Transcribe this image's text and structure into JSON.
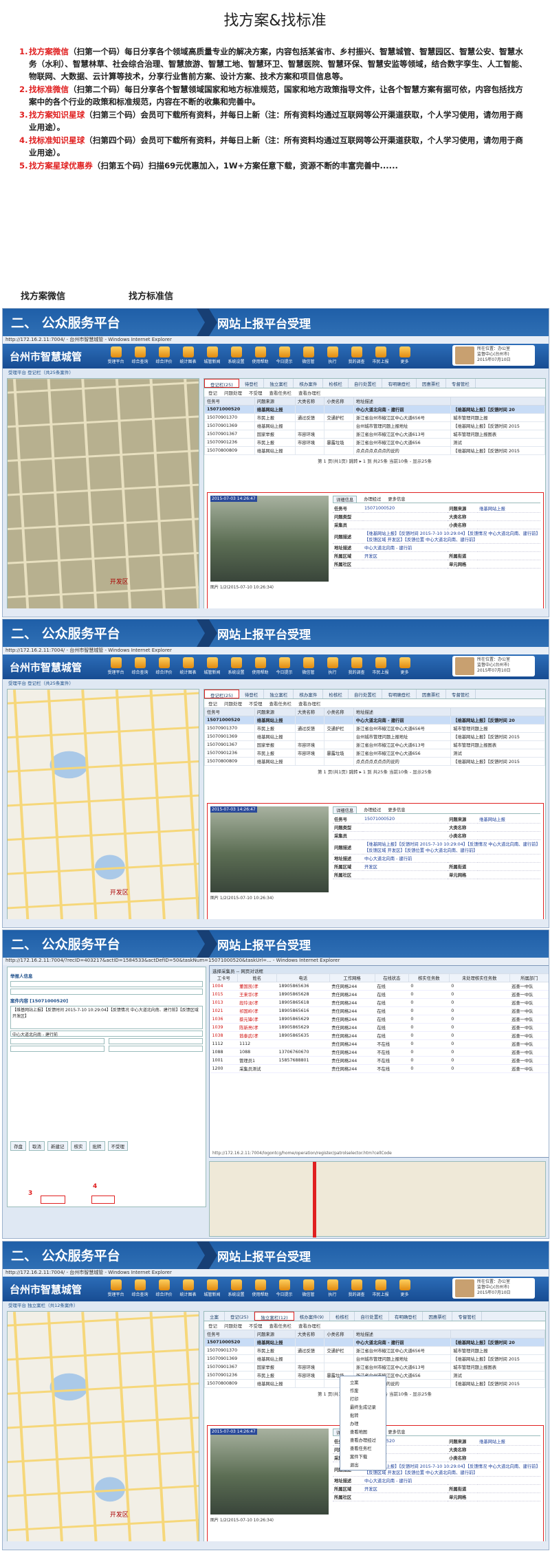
{
  "header": {
    "title": "找方案&找标准",
    "items": [
      {
        "num": "1.",
        "highlight": "找方案微信",
        "text": "（扫第一个码）每日分享各个领域高质量专业的解决方案，内容包括某省市、乡村振兴、智慧城管、智慧园区、智慧公安、智慧水务（水利）、智慧林草、社会综合治理、智慧旅游、智慧工地、智慧环卫、智慧医院、智慧环保、智慧安监等领域，结合数字孪生、人工智能、物联网、大数据、云计算等技术，分享行业售前方案、设计方案、技术方案和项目信息等。"
      },
      {
        "num": "2.",
        "highlight": "找标准微信",
        "text": "（扫第二个码）每日分享各个智慧领域国家和地方标准规范，国家和地方政策指导文件，让各个智慧方案有据可依，内容包括找方案中的各个行业的政策和标准规范，内容在不断的收集和完善中。"
      },
      {
        "num": "3.",
        "highlight": "找方案知识星球",
        "text": "（扫第三个码）会员可下载所有资料，并每日上新（注：所有资料均通过互联网等公开渠道获取，个人学习使用，请勿用于商业用途）。"
      },
      {
        "num": "4.",
        "highlight": "找标准知识星球",
        "text": "（扫第四个码）会员可下载所有资料，并每日上新（注：所有资料均通过互联网等公开渠道获取，个人学习使用，请勿用于商业用途）。"
      },
      {
        "num": "5.",
        "highlight": "找方案星球优惠券",
        "text": "（扫第五个码）扫描69元优惠加入，1W+方案任意下载，资源不断的丰富完善中......"
      }
    ],
    "qr1": "找方案微信",
    "qr2": "找方标准信"
  },
  "slide": {
    "title1": "二、 公众服务平台",
    "title2": "网站上报平台受理",
    "ie_title": "http://172.16.2.11:7004/ - 台州市智慧城管 - Windows Internet Explorer",
    "ie_title3": "http://172.16.2.11:7004/?recID=403217&actID=1584533&actDefID=50&taskNum=15071000520&taskUrl=... - Windows Internet Explorer",
    "app_name": "台州市智慧城管",
    "toolbar": [
      "受理平台",
      "综合查询",
      "综合评价",
      "统计图表",
      "城管新闻",
      "系统设置",
      "使用帮助",
      "今日提示",
      "微信管",
      "执行",
      "我的调查",
      "市民上报",
      "更多"
    ],
    "user_lines": [
      "所在位置：办公室",
      "监督中心(台州市)",
      "2015年07月10日"
    ],
    "logout": "注销",
    "crumb1": "受理平台 登记栏（共25条案件）",
    "crumb4": "受理平台 独立案栏（共12条案件）",
    "tabs": [
      "登记栏(25)",
      "待登栏",
      "独立案栏",
      "核办案件",
      "检核栏",
      "自行处置栏",
      "有明确登栏",
      "因惠票栏",
      "专督管栏"
    ],
    "tabs4": [
      "立案",
      "登记(25)",
      "独立案栏(12)",
      "核办案件(9)",
      "检核栏",
      "自行处置栏",
      "有明确登栏",
      "因惠票栏",
      "专督管栏"
    ],
    "actions": [
      "登记",
      "问题处理",
      "不受理",
      "查看任务栏",
      "查看办理栏"
    ],
    "columns": [
      "任务号",
      "问题来源",
      "大类名称",
      "小类名称",
      "地址描述"
    ],
    "rows": [
      [
        "15071000520",
        "维基网站上报",
        "",
        "",
        "中心大道北向南 - 建行前",
        "【维基网站上报】【反馈时间 20"
      ],
      [
        "15070901370",
        "市民上报",
        "通过反馈",
        "交通护栏",
        "浙江省台州市椒江区中心大道656号",
        "城市管理问题上报"
      ],
      [
        "15070901369",
        "维基网站上报",
        "",
        "",
        "台州城市管理问题上报地址",
        "【维基网站上报】【反馈时间 2015"
      ],
      [
        "15070901367",
        "国家举报",
        "市容环境",
        "",
        "浙江省台州市椒江区中心大道613号",
        "城市管理问题上报图表"
      ],
      [
        "15070901236",
        "市民上报",
        "市容环境",
        "暴露垃圾",
        "浙江省台州市椒江区中心大道656",
        "测试"
      ],
      [
        "15070800809",
        "维基网站上报",
        "",
        "",
        "点点点点点点点的说的",
        "【维基网站上报】【反馈时间 2015"
      ]
    ],
    "pager": "第 1 页(共1页) 跳转 ▸ 1 到 共25条 当前10条 - 显示25条",
    "detail_tabs": [
      "详细信息",
      "办理经过",
      "更多信息"
    ],
    "photo_stamp": "2015-07-03 14:26:47",
    "photo_caption": "图片 1/2(2015-07-10 10:26:34)",
    "fields": [
      [
        "任务号",
        "15071000520",
        "问题来源",
        "维基网站上报"
      ],
      [
        "问题类型",
        "",
        "大类名称",
        ""
      ],
      [
        "采集员",
        "",
        "小类名称",
        ""
      ],
      [
        "问题描述",
        "【维基网站上报】【反馈时间 2015-7-10 10:29:04】【反馈情况 中心大道北向南、建行前】【反馈区域 开发区】【反馈位置 中心大道北向南、建行前】",
        "",
        ""
      ],
      [
        "地址描述",
        "中心大道北向南 - 建行前",
        "",
        ""
      ],
      [
        "所属区域",
        "开发区",
        "所属街道",
        ""
      ],
      [
        "所属社区",
        "",
        "单元网格",
        ""
      ]
    ],
    "popup_title": "选择采集员 -- 网页对话框",
    "popup_cols": [
      "工卡号",
      "姓名",
      "电话",
      "工作网格",
      "在线状态",
      "核实任务数",
      "未处理核实任务数",
      "所属部门"
    ],
    "popup_rows": [
      [
        "1004",
        "董国凯(孝",
        "18905865636",
        "责任网格244",
        "在线",
        "0",
        "0",
        "巡查一中队"
      ],
      [
        "1015",
        "王来华(孝",
        "18905865628",
        "责任网格244",
        "在线",
        "0",
        "0",
        "巡查一中队"
      ],
      [
        "1013",
        "段玲淡(孝",
        "18905865618",
        "责任网格244",
        "在线",
        "0",
        "0",
        "巡查一中队"
      ],
      [
        "1021",
        "祁国岭(孝",
        "18905865616",
        "责任网格244",
        "在线",
        "0",
        "0",
        "巡查一中队"
      ],
      [
        "1036",
        "蔡元锋(孝",
        "18905865629",
        "责任网格244",
        "在线",
        "0",
        "0",
        "巡查一中队"
      ],
      [
        "1039",
        "陈新亮(孝",
        "18905865629",
        "责任网格244",
        "在线",
        "0",
        "0",
        "巡查一中队"
      ],
      [
        "1038",
        "翁泰武(孝",
        "18905865635",
        "责任网格244",
        "在线",
        "0",
        "0",
        "巡查一中队"
      ],
      [
        "1112",
        "1112",
        "",
        "责任网格244",
        "不在线",
        "0",
        "0",
        "巡查一中队"
      ],
      [
        "1088",
        "1088",
        "13706760670",
        "责任网格244",
        "不在线",
        "0",
        "0",
        "巡查一中队"
      ],
      [
        "1001",
        "管理员1",
        "15857688801",
        "责任网格244",
        "不在线",
        "0",
        "0",
        "巡查一中队"
      ],
      [
        "1200",
        "采集员测试",
        "",
        "责任网格244",
        "不在线",
        "0",
        "0",
        "巡查一中队"
      ]
    ],
    "popup_url": "http://172.16.2.11:7004/logontcg/home/operation/register/patrolselector.htm?cellCode",
    "form_sec1": "举报人信息",
    "form_sec2": "案件内容 [15071000520]",
    "form_desc": "【维基网站上报】【反馈时间 2015-7-10 10:29:04】【反馈情况 中心大道北向南、建行前】【反馈区域 开发区】",
    "form_addr": "中心大道北向南 - 建行前",
    "form_btns": [
      "存盘",
      "取消",
      "新建记",
      "核实",
      "批转",
      "不受理"
    ],
    "step3": "3",
    "step4": "4",
    "ctx_menu": [
      "立案",
      "作废",
      "打印",
      "最终生成记录",
      "批转",
      "办理",
      "查看地图",
      "查看办理经过",
      "查看任务栏",
      "案件下载",
      "退出"
    ],
    "map_label": "开发区"
  }
}
